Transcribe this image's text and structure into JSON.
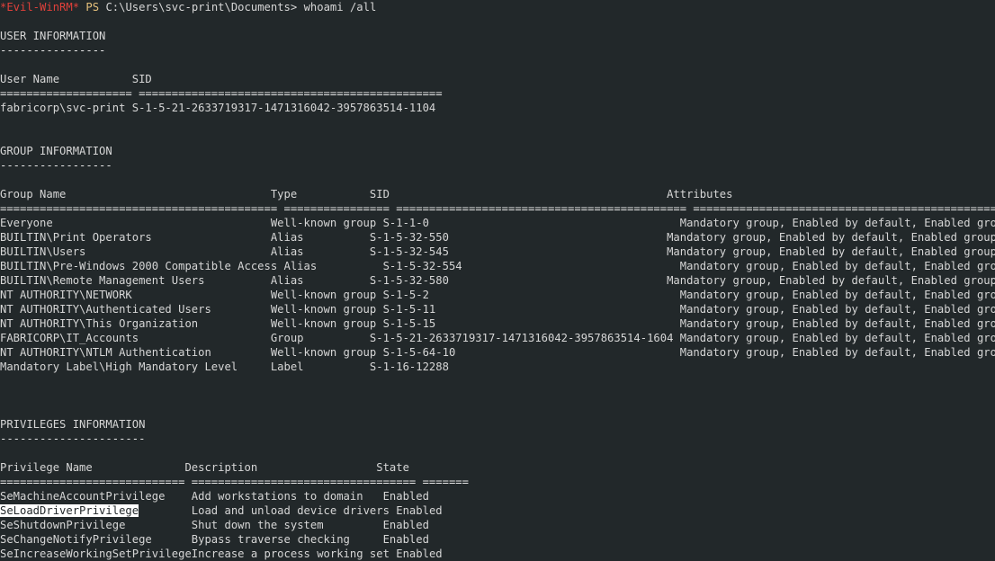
{
  "terminal": {
    "background_color": "#22282a",
    "foreground_color": "#d6d6d6",
    "prompt_accent_color": "#e0403a",
    "ps_color": "#e5c07b",
    "selection_background": "#ffffff",
    "selection_foreground": "#22282a"
  },
  "prompt": {
    "shell_tag": "*Evil-WinRM*",
    "ps_label": "PS",
    "path": "C:\\Users\\svc-print\\Documents>",
    "command": "whoami /all"
  },
  "sections": {
    "user": {
      "heading": "USER INFORMATION",
      "heading_rule": "----------------",
      "columns": [
        "User Name",
        "SID"
      ],
      "column_rules": [
        "====================",
        "=============================================="
      ],
      "rows": [
        {
          "user_name": "fabricorp\\svc-print",
          "sid": "S-1-5-21-2633719317-1471316042-3957863514-1104"
        }
      ]
    },
    "group": {
      "heading": "GROUP INFORMATION",
      "heading_rule": "-----------------",
      "columns": [
        "Group Name",
        "Type",
        "SID",
        "Attributes"
      ],
      "column_rules": [
        "==========================================",
        "================",
        "============================================",
        "==================================================",
        "=============================================="
      ],
      "rows": [
        {
          "name": "Everyone",
          "type": "Well-known group",
          "sid": "S-1-1-0",
          "attributes": "Mandatory group, Enabled by default, Enabled group"
        },
        {
          "name": "BUILTIN\\Print Operators",
          "type": "Alias",
          "sid": "S-1-5-32-550",
          "attributes": "Mandatory group, Enabled by default, Enabled group"
        },
        {
          "name": "BUILTIN\\Users",
          "type": "Alias",
          "sid": "S-1-5-32-545",
          "attributes": "Mandatory group, Enabled by default, Enabled group"
        },
        {
          "name": "BUILTIN\\Pre-Windows 2000 Compatible Access",
          "type": "Alias",
          "sid": "S-1-5-32-554",
          "attributes": "Mandatory group, Enabled by default, Enabled group"
        },
        {
          "name": "BUILTIN\\Remote Management Users",
          "type": "Alias",
          "sid": "S-1-5-32-580",
          "attributes": "Mandatory group, Enabled by default, Enabled group"
        },
        {
          "name": "NT AUTHORITY\\NETWORK",
          "type": "Well-known group",
          "sid": "S-1-5-2",
          "attributes": "Mandatory group, Enabled by default, Enabled group"
        },
        {
          "name": "NT AUTHORITY\\Authenticated Users",
          "type": "Well-known group",
          "sid": "S-1-5-11",
          "attributes": "Mandatory group, Enabled by default, Enabled group"
        },
        {
          "name": "NT AUTHORITY\\This Organization",
          "type": "Well-known group",
          "sid": "S-1-5-15",
          "attributes": "Mandatory group, Enabled by default, Enabled group"
        },
        {
          "name": "FABRICORP\\IT_Accounts",
          "type": "Group",
          "sid": "S-1-5-21-2633719317-1471316042-3957863514-1604",
          "attributes": "Mandatory group, Enabled by default, Enabled group"
        },
        {
          "name": "NT AUTHORITY\\NTLM Authentication",
          "type": "Well-known group",
          "sid": "S-1-5-64-10",
          "attributes": "Mandatory group, Enabled by default, Enabled group"
        },
        {
          "name": "Mandatory Label\\High Mandatory Level",
          "type": "Label",
          "sid": "S-1-16-12288",
          "attributes": ""
        }
      ]
    },
    "privileges": {
      "heading": "PRIVILEGES INFORMATION",
      "heading_rule": "----------------------",
      "columns": [
        "Privilege Name",
        "Description",
        "State"
      ],
      "column_rules": [
        "============================",
        "==================================",
        "======="
      ],
      "rows": [
        {
          "privilege": "SeMachineAccountPrivilege",
          "description": "Add workstations to domain",
          "state": "Enabled",
          "selected": false
        },
        {
          "privilege": "SeLoadDriverPrivilege",
          "description": "Load and unload device drivers",
          "state": "Enabled",
          "selected": true
        },
        {
          "privilege": "SeShutdownPrivilege",
          "description": "Shut down the system",
          "state": "Enabled",
          "selected": false
        },
        {
          "privilege": "SeChangeNotifyPrivilege",
          "description": "Bypass traverse checking",
          "state": "Enabled",
          "selected": false
        },
        {
          "privilege": "SeIncreaseWorkingSetPrivilege",
          "description": "Increase a process working set",
          "state": "Enabled",
          "selected": false
        }
      ]
    }
  },
  "layout": {
    "group_col_starts": [
      0,
      42,
      58,
      104
    ],
    "priv_col_starts": [
      0,
      29,
      59
    ]
  }
}
